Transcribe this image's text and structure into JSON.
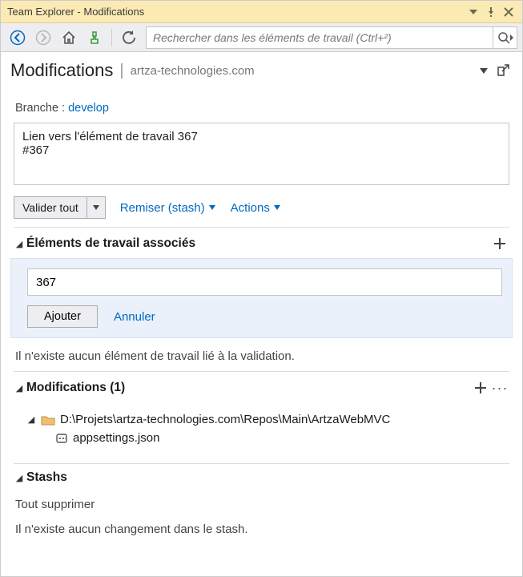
{
  "window": {
    "title": "Team Explorer - Modifications"
  },
  "search": {
    "placeholder": "Rechercher dans les éléments de travail (Ctrl+²)"
  },
  "header": {
    "page": "Modifications",
    "host": "artza-technologies.com"
  },
  "branch": {
    "label": "Branche : ",
    "name": "develop"
  },
  "commit": {
    "message": "Lien vers l'élément de travail 367\n#367"
  },
  "actions": {
    "validate": "Valider tout",
    "stash": "Remiser (stash)",
    "more": "Actions"
  },
  "associated": {
    "title": "Éléments de travail associés",
    "input_value": "367",
    "add": "Ajouter",
    "cancel": "Annuler",
    "empty": "Il n'existe aucun élément de travail lié à la validation."
  },
  "modifications": {
    "title": "Modifications (1)",
    "repo_path": "D:\\Projets\\artza-technologies.com\\Repos\\Main\\ArtzaWebMVC",
    "file": "appsettings.json"
  },
  "stashs": {
    "title": "Stashs",
    "delete_all": "Tout supprimer",
    "empty": "Il n'existe aucun changement dans le stash."
  }
}
